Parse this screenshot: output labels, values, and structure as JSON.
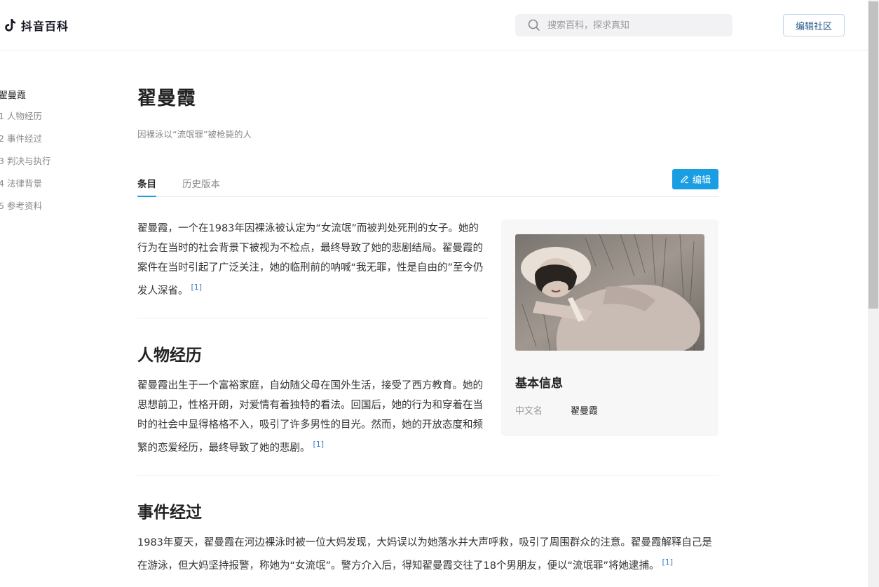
{
  "header": {
    "logo_text": "抖音百科",
    "search_placeholder": "搜索百科，探求真知",
    "community_button": "编辑社区"
  },
  "toc": {
    "title": "翟曼霞",
    "items": [
      {
        "num": "1",
        "label": "人物经历"
      },
      {
        "num": "2",
        "label": "事件经过"
      },
      {
        "num": "3",
        "label": "判决与执行"
      },
      {
        "num": "4",
        "label": "法律背景"
      },
      {
        "num": "5",
        "label": "参考资料"
      }
    ]
  },
  "article": {
    "title": "翟曼霞",
    "subtitle": "因裸泳以“流氓罪”被枪毙的人",
    "tabs": [
      {
        "label": "条目",
        "active": true
      },
      {
        "label": "历史版本",
        "active": false
      }
    ],
    "edit_button": "编辑",
    "intro": "翟曼霞，一个在1983年因裸泳被认定为“女流氓”而被判处死刑的女子。她的行为在当时的社会背景下被视为不检点，最终导致了她的悲剧结局。翟曼霞的案件在当时引起了广泛关注，她的临刑前的呐喊“我无罪，性是自由的”至今仍发人深省。",
    "intro_ref": "[1]",
    "sections": [
      {
        "heading": "人物经历",
        "body": "翟曼霞出生于一个富裕家庭，自幼随父母在国外生活，接受了西方教育。她的思想前卫，性格开朗，对爱情有着独特的看法。回国后，她的行为和穿着在当时的社会中显得格格不入，吸引了许多男性的目光。然而，她的开放态度和频繁的恋爱经历，最终导致了她的悲剧。",
        "ref": "[1]"
      },
      {
        "heading": "事件经过",
        "body": "1983年夏天，翟曼霞在河边裸泳时被一位大妈发现，大妈误以为她落水并大声呼救，吸引了周围群众的注意。翟曼霞解释自己是在游泳，但大妈坚持报警，称她为“女流氓”。警方介入后，得知翟曼霞交往了18个男朋友，便以“流氓罪”将她逮捕。",
        "ref": "[1]"
      }
    ]
  },
  "infobox": {
    "title": "基本信息",
    "fields": [
      {
        "label": "中文名",
        "value": "翟曼霞"
      }
    ]
  },
  "colors": {
    "accent": "#1a9ee3",
    "link": "#3a7bc8",
    "border": "#eeeeee"
  }
}
